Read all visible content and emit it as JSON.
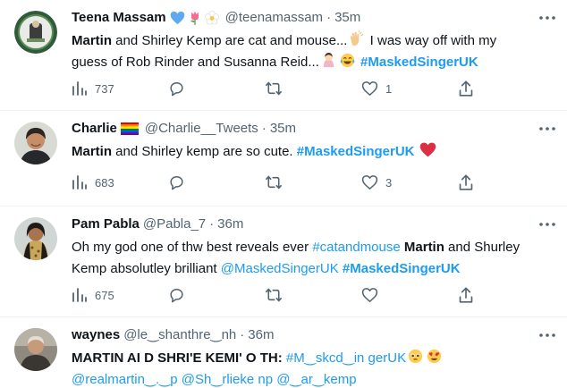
{
  "tweets": [
    {
      "name": "Teena Massam",
      "handle": "@teenamassam",
      "dot": "·",
      "time": "35m",
      "text": {
        "t1": "Martin",
        "t2": " and Shirley Kemp are cat and mouse...",
        "t3": " I was way off with my guess of Rob Rinder and Susanna Reid...",
        "t4": "#MaskedSingerUK"
      },
      "views": "737",
      "replies": "",
      "retweets": "",
      "likes": "1"
    },
    {
      "name": "Charlie",
      "handle": "@Charlie__Tweets",
      "dot": "·",
      "time": "35m",
      "text": {
        "t1": "Martin",
        "t2": " and Shirley kemp are so cute. ",
        "t3": "#MaskedSingerUK"
      },
      "views": "683",
      "replies": "",
      "retweets": "",
      "likes": "3"
    },
    {
      "name": "Pam Pabla",
      "handle": "@Pabla_7",
      "dot": "·",
      "time": "36m",
      "text": {
        "t1": "Oh my god one of thw best reveals ever ",
        "t2": "#catandmouse",
        "t3": "Martin",
        "t4": " and Shurley Kemp absolutley brilliant ",
        "t5": "@MaskedSingerUK",
        "t6": "#MaskedSingerUK"
      },
      "views": "675",
      "replies": "",
      "retweets": "",
      "likes": ""
    },
    {
      "name": "waynes",
      "handle": "@le‿shanthre‿nh",
      "dot": "·",
      "time": "36m",
      "text": {
        "t1": "MARTIN AI D SHRI'E KEMI' O TH:",
        "t2": "#M‿skcd‿in gerUK",
        "t3": "@realmartin‿.‿p",
        "t4": "@Sh‿rlieke np",
        "t5": "@‿ar‿kemp"
      }
    }
  ],
  "colors": {
    "link": "#1d9bf0",
    "secondary": "#536471",
    "like_red": "#f91880"
  }
}
